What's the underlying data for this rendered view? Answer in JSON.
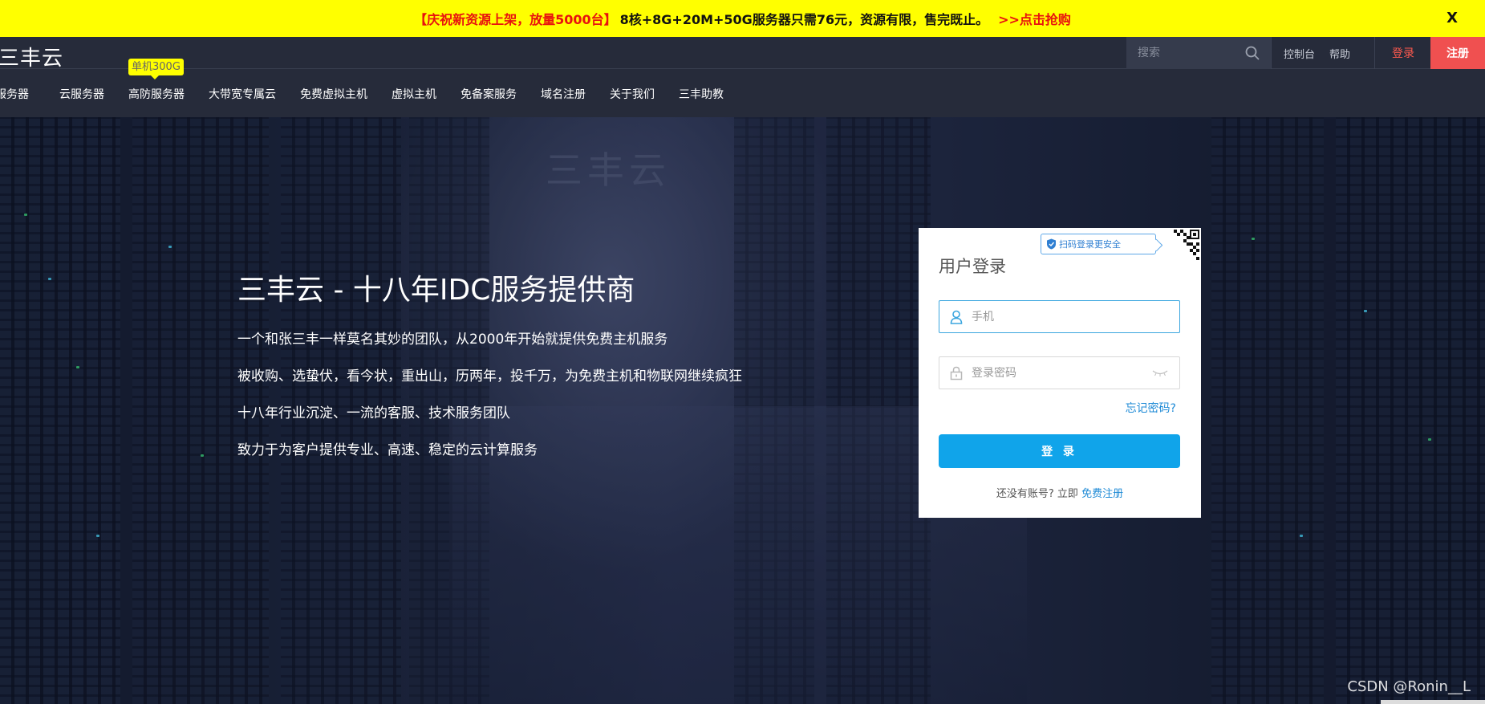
{
  "promo": {
    "highlight": "【庆祝新资源上架，放量5000台】",
    "main": "8核+8G+20M+50G服务器只需76元，资源有限，售完既止。",
    "cta": ">>点击抢购",
    "close": "X"
  },
  "header": {
    "logo": "三丰云",
    "search_placeholder": "搜索",
    "links": [
      "控制台",
      "帮助"
    ],
    "login": "登录",
    "register": "注册"
  },
  "nav": {
    "badge": "单机300G",
    "items": [
      "云服务器",
      "云服务器",
      "高防服务器",
      "大带宽专属云",
      "免费虚拟主机",
      "虚拟主机",
      "免备案服务",
      "域名注册",
      "关于我们",
      "三丰助教"
    ],
    "first_item_visible": "服务器"
  },
  "hero": {
    "bg_logo": "三丰云",
    "title": "三丰云 - 十八年IDC服务提供商",
    "lines": [
      "一个和张三丰一样莫名其妙的团队，从2000年开始就提供免费主机服务",
      "被收购、选蛰伏，看今状，重出山，历两年，投千万，为免费主机和物联网继续疯狂",
      "十八年行业沉淀、一流的客服、技术服务团队",
      "致力于为客户提供专业、高速、稳定的云计算服务"
    ]
  },
  "login_box": {
    "qr_tip": "扫码登录更安全",
    "title": "用户登录",
    "phone_placeholder": "手机",
    "password_placeholder": "登录密码",
    "forgot": "忘记密码?",
    "submit": "登 录",
    "no_account": "还没有账号? 立即",
    "register_link": "免费注册"
  },
  "watermark": "CSDN @Ronin__L",
  "colors": {
    "promo_bg": "#ffff00",
    "header_bg": "#262b3a",
    "register_bg": "#f05050",
    "login_btn": "#10a4ea",
    "link_blue": "#1e8ad6"
  }
}
